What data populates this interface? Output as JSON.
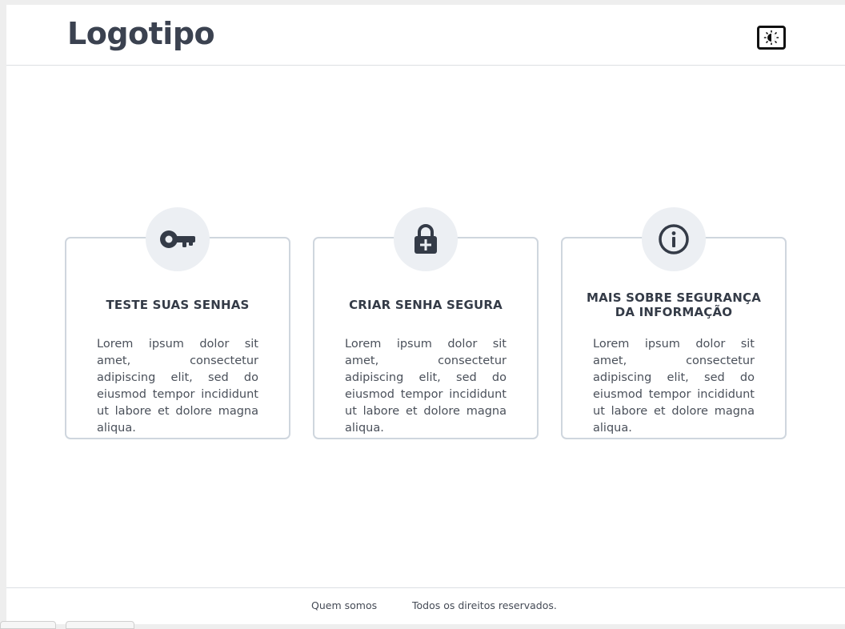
{
  "header": {
    "logo": "Logotipo",
    "theme_toggle_icon": "contrast-icon"
  },
  "cards": [
    {
      "icon": "key-icon",
      "title": "TESTE SUAS SENHAS",
      "text": "Lorem ipsum dolor sit amet, consectetur adipiscing elit, sed do eiusmod tempor incididunt ut labore et dolore magna aliqua."
    },
    {
      "icon": "lock-plus-icon",
      "title": "CRIAR SENHA SEGURA",
      "text": "Lorem ipsum dolor sit amet, consectetur adipiscing elit, sed do eiusmod tempor incididunt ut labore et dolore magna aliqua."
    },
    {
      "icon": "info-icon",
      "title": "MAIS SOBRE SEGURANÇA DA INFORMAÇÃO",
      "text": "Lorem ipsum dolor sit amet, consectetur adipiscing elit, sed do eiusmod tempor incididunt ut labore et dolore magna aliqua."
    }
  ],
  "footer": {
    "about_link": "Quem somos",
    "rights": "Todos os direitos reservados."
  },
  "colors": {
    "text": "#333a45",
    "card_border": "#cfd6de",
    "icon_bg": "#eceff3",
    "icon_fg": "#343b47"
  }
}
